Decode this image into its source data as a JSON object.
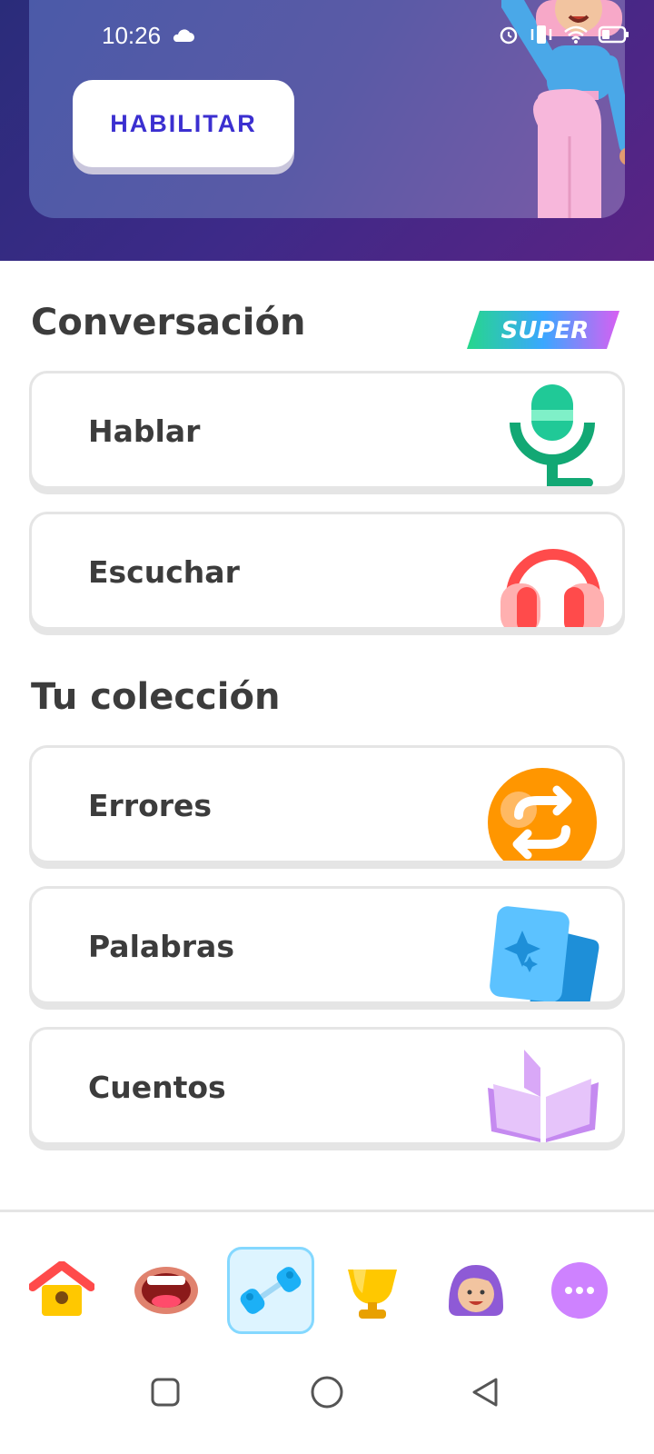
{
  "status_bar": {
    "time": "10:26"
  },
  "hero": {
    "enable_button": "HABILITAR"
  },
  "conversation": {
    "title": "Conversación",
    "badge": "SUPER",
    "items": [
      {
        "label": "Hablar",
        "icon": "microphone-icon"
      },
      {
        "label": "Escuchar",
        "icon": "headphones-icon"
      }
    ]
  },
  "collection": {
    "title": "Tu colección",
    "items": [
      {
        "label": "Errores",
        "icon": "mistakes-refresh-icon"
      },
      {
        "label": "Palabras",
        "icon": "flashcards-icon"
      },
      {
        "label": "Cuentos",
        "icon": "book-icon"
      }
    ]
  },
  "bottom_nav": [
    {
      "icon": "home-icon",
      "active": false
    },
    {
      "icon": "speak-mouth-icon",
      "active": false
    },
    {
      "icon": "practice-dumbbell-icon",
      "active": true
    },
    {
      "icon": "leaderboard-trophy-icon",
      "active": false
    },
    {
      "icon": "profile-avatar-icon",
      "active": false
    },
    {
      "icon": "more-icon",
      "active": false
    }
  ],
  "colors": {
    "accent_blue": "#3b2fd0",
    "active_tab_bg": "#ddf4ff",
    "active_tab_border": "#84d8ff",
    "card_border": "#e5e5e5"
  }
}
